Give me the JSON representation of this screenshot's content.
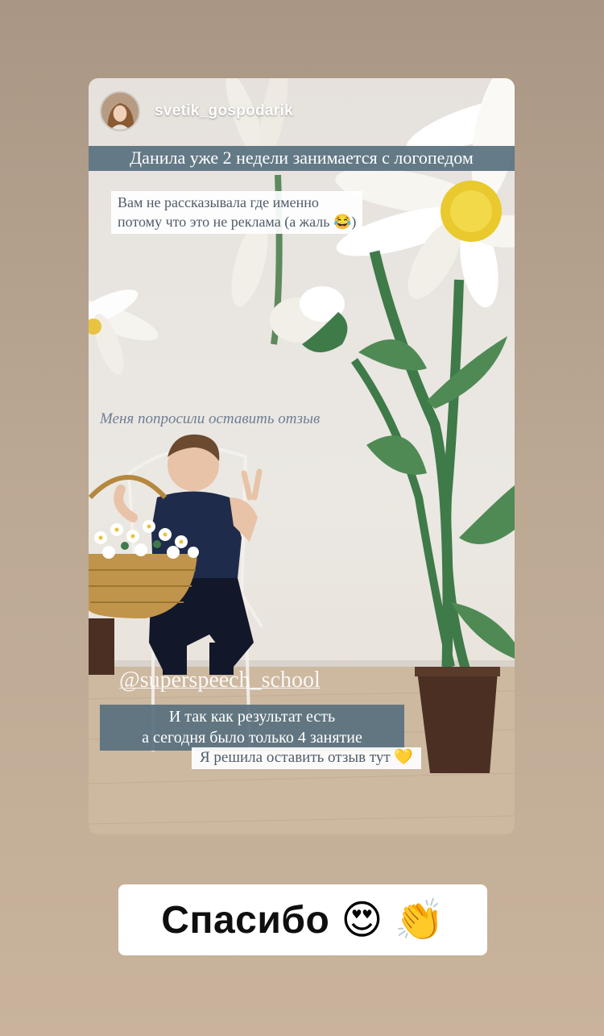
{
  "story": {
    "username": "svetik_gospodarik",
    "captions": {
      "line1": "Данила уже 2 недели занимается с логопедом",
      "line2a": "Вам не рассказывала где именно",
      "line2b": "потому что это не реклама (а жаль 😂)",
      "line3": "Меня попросили оставить отзыв",
      "mention": "@superspeech_school",
      "line4a": "И так как результат есть",
      "line4b": "а сегодня было только 4 занятие",
      "line5": "Я решила оставить отзыв тут 💛"
    }
  },
  "footer": {
    "thanks_text": "Спасибо",
    "emoji1": "😍",
    "emoji2": "👏"
  },
  "icons": [
    "avatar-photo",
    "heart-eyes-emoji",
    "clapping-hands-emoji"
  ]
}
